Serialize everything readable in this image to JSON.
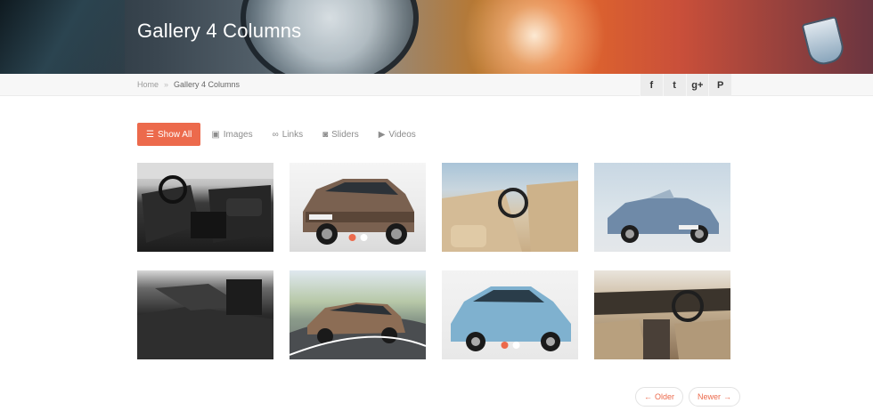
{
  "header": {
    "title": "Gallery 4 Columns"
  },
  "breadcrumb": {
    "home": "Home",
    "separator": "»",
    "current": "Gallery 4 Columns"
  },
  "social": [
    {
      "icon": "facebook-icon",
      "glyph": "f"
    },
    {
      "icon": "twitter-icon",
      "glyph": "t"
    },
    {
      "icon": "google-plus-icon",
      "glyph": "g+"
    },
    {
      "icon": "pinterest-icon",
      "glyph": "P"
    }
  ],
  "filters": [
    {
      "label": "Show All",
      "icon": "list-icon",
      "glyph": "☰",
      "active": true
    },
    {
      "label": "Images",
      "icon": "image-icon",
      "glyph": "▣",
      "active": false
    },
    {
      "label": "Links",
      "icon": "link-icon",
      "glyph": "∞",
      "active": false
    },
    {
      "label": "Sliders",
      "icon": "camera-icon",
      "glyph": "◙",
      "active": false
    },
    {
      "label": "Videos",
      "icon": "play-icon",
      "glyph": "▶",
      "active": false
    }
  ],
  "gallery": [
    {
      "subject": "car interior rear seats",
      "slider": false
    },
    {
      "subject": "brown SUV",
      "slider": true,
      "active_dot": 0
    },
    {
      "subject": "beige interior dashboard",
      "slider": false
    },
    {
      "subject": "blue convertible",
      "slider": false
    },
    {
      "subject": "cargo area interior",
      "slider": false
    },
    {
      "subject": "brown sedan on road",
      "slider": false
    },
    {
      "subject": "light blue hatchback",
      "slider": true,
      "active_dot": 0
    },
    {
      "subject": "beige dashboard interior",
      "slider": false
    }
  ],
  "pager": {
    "older": "Older",
    "newer": "Newer",
    "older_arrow": "←",
    "newer_arrow": "→"
  },
  "colors": {
    "accent": "#ec6a4c",
    "breadcrumb_bar": "#f7f7f7",
    "social_bg": "#ececec"
  }
}
